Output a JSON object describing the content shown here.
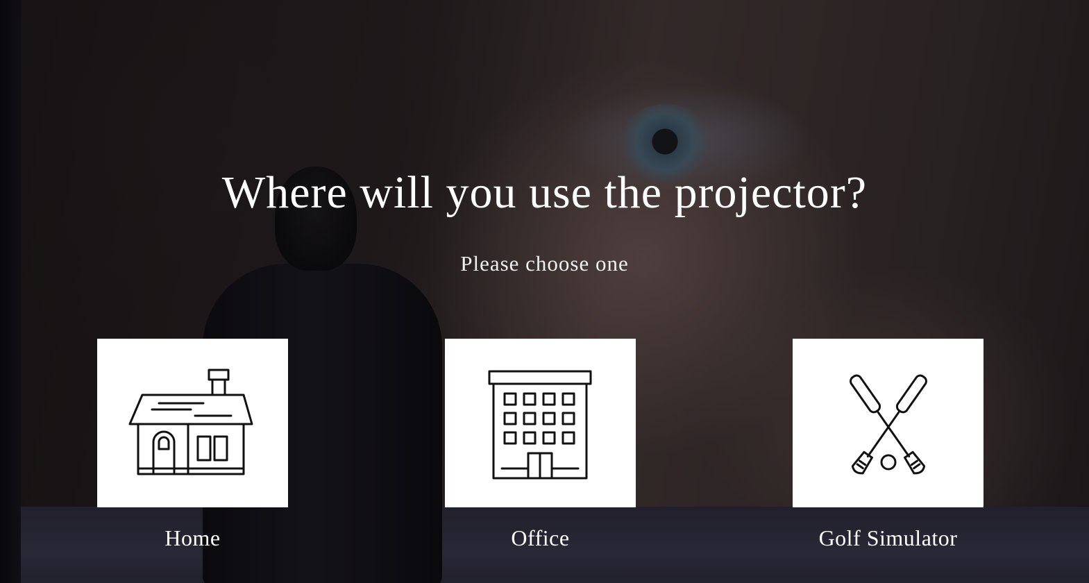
{
  "page": {
    "title": "Where will you use the projector?",
    "subtitle": "Please choose one"
  },
  "options": [
    {
      "label": "Home",
      "icon": "house-icon"
    },
    {
      "label": "Office",
      "icon": "office-building-icon"
    },
    {
      "label": "Golf Simulator",
      "icon": "golf-clubs-icon"
    }
  ],
  "colors": {
    "text": "#ffffff",
    "card": "#ffffff",
    "icon_stroke": "#111111"
  }
}
